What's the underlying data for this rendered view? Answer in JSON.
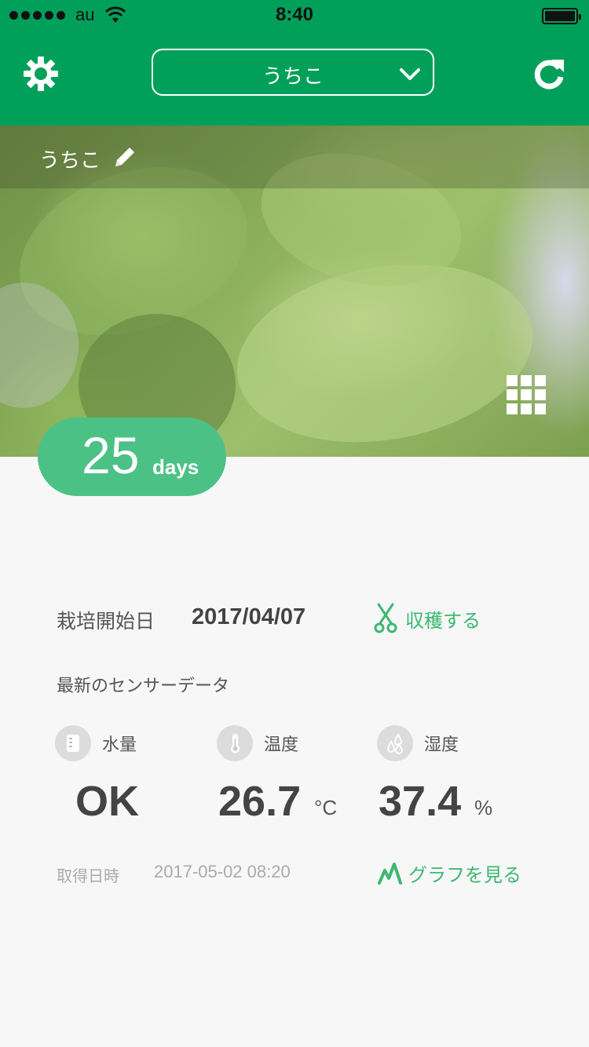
{
  "status_bar": {
    "carrier": "au",
    "time": "8:40"
  },
  "header": {
    "selector_label": "うちこ",
    "left_icon": "gear-icon",
    "right_icon": "refresh-icon",
    "color": "#00a05a"
  },
  "photo": {
    "plant_name": "うちこ",
    "edit_icon": "pencil-icon",
    "gallery_icon": "grid-icon"
  },
  "days": {
    "number": "25",
    "unit": "days",
    "color": "#4cc186"
  },
  "cultivation": {
    "start_label": "栽培開始日",
    "start_date": "2017/04/07",
    "harvest_label": "収穫する",
    "harvest_icon": "scissors-icon"
  },
  "sensor": {
    "title": "最新のセンサーデータ",
    "metrics": [
      {
        "label": "水量",
        "value": "OK",
        "unit": "",
        "icon": "water-tank-icon"
      },
      {
        "label": "温度",
        "value": "26.7",
        "unit": "°C",
        "icon": "thermometer-icon"
      },
      {
        "label": "湿度",
        "value": "37.4",
        "unit": "%",
        "icon": "humidity-drops-icon"
      }
    ],
    "acquired_label": "取得日時",
    "acquired_value": "2017-05-02 08:20",
    "graph_label": "グラフを見る",
    "graph_icon": "graph-icon"
  },
  "accent_color": "#3db872"
}
